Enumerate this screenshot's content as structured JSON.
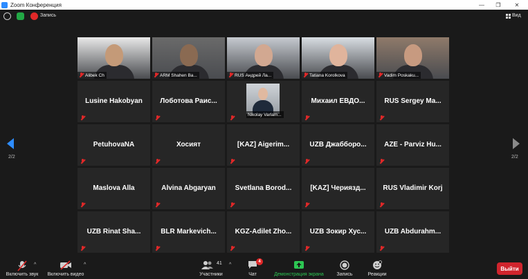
{
  "window": {
    "title": "Zoom Конференция"
  },
  "infobar": {
    "record_label": "Запись",
    "view_label": "Вид"
  },
  "tiles": [
    {
      "name": "Alibek Ch",
      "video": true,
      "skin": "#c49a78",
      "bg": "#e8e8e8"
    },
    {
      "name": "ARM Shahen Ba...",
      "video": true,
      "skin": "#8a6a52",
      "bg": "#6a6a6a"
    },
    {
      "name": "RUS Андрей Ла...",
      "video": true,
      "skin": "#d2a891",
      "bg": "#c6cad0"
    },
    {
      "name": "Tatiana Korolkova",
      "video": true,
      "skin": "#e0b49c",
      "bg": "#d8dde2"
    },
    {
      "name": "Vadim Poskaku...",
      "video": true,
      "skin": "#c79a80",
      "bg": "#8f7a6a"
    },
    {
      "name": "Lusine Hakobyan",
      "video": false
    },
    {
      "name": "Лоботова Раис...",
      "video": false
    },
    {
      "name": "Nikolay Varlam...",
      "video": false,
      "self": true
    },
    {
      "name": "Михаил ЕВДО...",
      "video": false
    },
    {
      "name": "RUS Sergey Ma...",
      "video": false
    },
    {
      "name": "PetuhovaNA",
      "video": false
    },
    {
      "name": "Хосият",
      "video": false
    },
    {
      "name": "[KAZ] Aigerim...",
      "video": false
    },
    {
      "name": "UZB Джабборо...",
      "video": false
    },
    {
      "name": "AZE - Parviz Hu...",
      "video": false
    },
    {
      "name": "Maslova Alla",
      "video": false
    },
    {
      "name": "Alvina Abgaryan",
      "video": false
    },
    {
      "name": "Svetlana Borod...",
      "video": false
    },
    {
      "name": "[KAZ] Чериязд...",
      "video": false
    },
    {
      "name": "RUS Vladimir Korj",
      "video": false
    },
    {
      "name": "UZB Rinat Sha...",
      "video": false
    },
    {
      "name": "BLR Markevich...",
      "video": false
    },
    {
      "name": "KGZ-Adilet Zho...",
      "video": false
    },
    {
      "name": "UZB Зокир Хус...",
      "video": false
    },
    {
      "name": "UZB Abdurahm...",
      "video": false
    }
  ],
  "pagination": {
    "left_page": "2/2",
    "right_page": "2/2"
  },
  "toolbar": {
    "unmute_label": "Включить звук",
    "video_label": "Включить видео",
    "participants_label": "Участники",
    "participants_count": "41",
    "chat_label": "Чат",
    "chat_badge": "4",
    "share_label": "Демонстрация экрана",
    "record_label": "Запись",
    "reactions_label": "Реакции",
    "leave_label": "Выйти"
  },
  "colors": {
    "leave": "#d0242d",
    "share": "#2dc653",
    "mute": "#e02828",
    "nav_arrow": "#2d8cff"
  }
}
